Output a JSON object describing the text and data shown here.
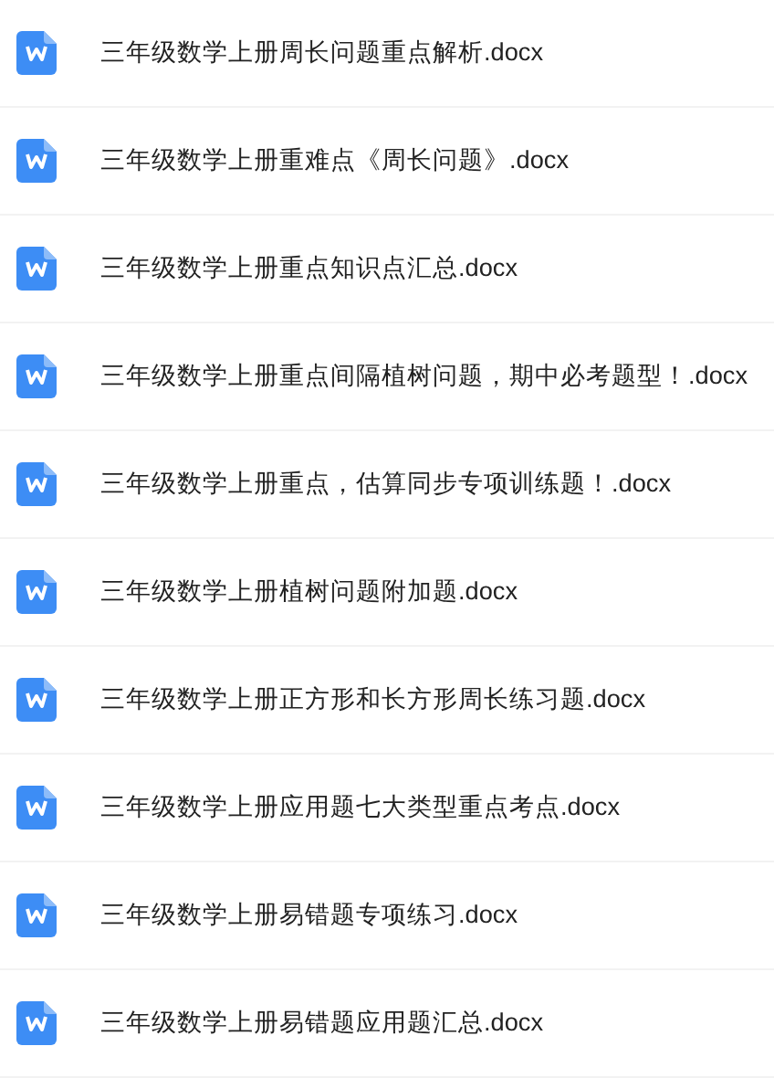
{
  "files": [
    {
      "name": "三年级数学上册周长问题重点解析.docx"
    },
    {
      "name": "三年级数学上册重难点《周长问题》.docx"
    },
    {
      "name": "三年级数学上册重点知识点汇总.docx"
    },
    {
      "name": "三年级数学上册重点间隔植树问题，期中必考题型！.docx"
    },
    {
      "name": "三年级数学上册重点，估算同步专项训练题！.docx"
    },
    {
      "name": "三年级数学上册植树问题附加题.docx"
    },
    {
      "name": "三年级数学上册正方形和长方形周长练习题.docx"
    },
    {
      "name": "三年级数学上册应用题七大类型重点考点.docx"
    },
    {
      "name": "三年级数学上册易错题专项练习.docx"
    },
    {
      "name": "三年级数学上册易错题应用题汇总.docx"
    }
  ]
}
